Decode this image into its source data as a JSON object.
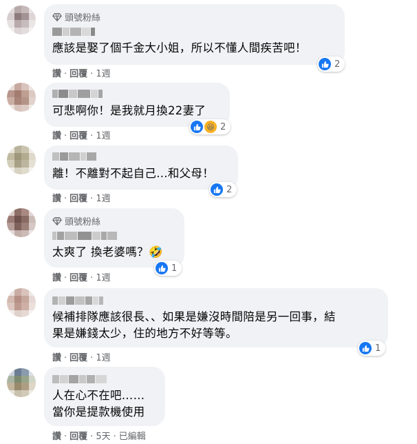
{
  "badge_label": "頭號粉絲",
  "actions": {
    "like": "讚",
    "reply": "回覆",
    "dot": "·",
    "edited": "已編輯"
  },
  "comments": [
    {
      "text": "應該是娶了個千金大小姐，所以不懂人間疾苦吧！",
      "time": "1週",
      "reactions": [
        "like-icon"
      ],
      "count": "2",
      "fan_badge": true
    },
    {
      "text": "可悲啊你！是我就月換22妻了",
      "time": "1週",
      "reactions": [
        "like-icon",
        "haha-icon"
      ],
      "count": "2",
      "fan_badge": false
    },
    {
      "text": "離！不離對不起自己...和父母！",
      "time": "1週",
      "reactions": [
        "like-icon"
      ],
      "count": "2",
      "fan_badge": false
    },
    {
      "text": "太爽了 換老婆嗎？🤣",
      "time": "1週",
      "reactions": [
        "like-icon"
      ],
      "count": "1",
      "fan_badge": true
    },
    {
      "text_lines": [
        "候補排隊應該很長、、如果是嫌沒時間陪是另一回事，結",
        "果是嫌錢太少，住的地方不好等等。"
      ],
      "time": "1週",
      "reactions": [
        "like-icon"
      ],
      "count": "1",
      "fan_badge": false
    },
    {
      "text_lines": [
        "人在心不在吧……",
        "當你是提款機使用"
      ],
      "time": "5天",
      "edited": true,
      "fan_badge": false
    }
  ],
  "colors": {
    "bubble": "#f0f2f5",
    "like": "#1877f2",
    "meta": "#65676b"
  }
}
